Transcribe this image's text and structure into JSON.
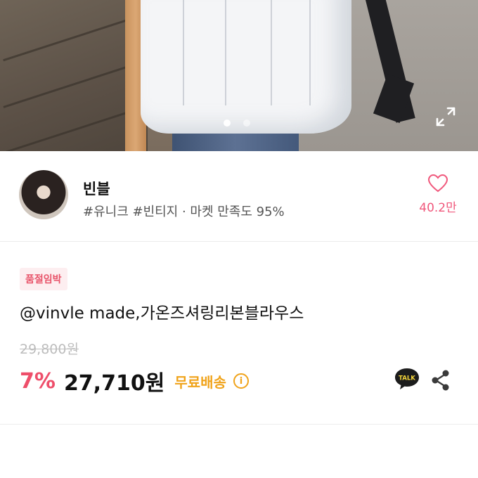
{
  "hero": {
    "carousel_total": 2,
    "carousel_active": 1
  },
  "seller": {
    "name": "빈블",
    "tags": "#유니크 #빈티지 · 마켓 만족도 95%",
    "like_count": "40.2만"
  },
  "product": {
    "badge": "품절임박",
    "title": "@vinvle made,가온즈셔링리본블라우스",
    "original_price": "29,800원",
    "discount": "7%",
    "price": "27,710원",
    "shipping": "무료배송",
    "info_symbol": "i",
    "talk_label": "TALK"
  },
  "colors": {
    "accent_pink": "#ee4e6a",
    "shipping_orange": "#f0a31a",
    "like_pink": "#f0587c"
  },
  "icons": [
    "expand-icon",
    "heart-icon",
    "info-icon",
    "kakao-talk-icon",
    "share-icon"
  ]
}
